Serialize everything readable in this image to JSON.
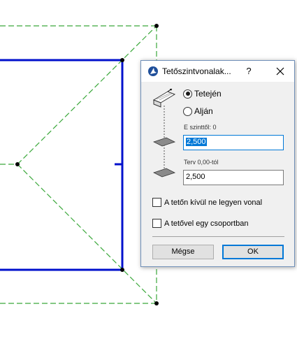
{
  "dialog": {
    "title": "Tetőszintvonalak...",
    "help_label": "?",
    "radio_options": [
      {
        "label": "Tetején",
        "checked": true
      },
      {
        "label": "Alján",
        "checked": false
      }
    ],
    "field1": {
      "label": "E szinttől: 0",
      "value": "2,500"
    },
    "field2": {
      "label": "Terv 0,00-tól",
      "value": "2,500"
    },
    "checkboxes": [
      {
        "label": "A tetőn kívül ne legyen vonal",
        "checked": false
      },
      {
        "label": "A tetővel egy csoportban",
        "checked": false
      }
    ],
    "cancel_label": "Mégse",
    "ok_label": "OK"
  },
  "colors": {
    "wall_blue": "#0010cc",
    "roof_line_green": "#3aa83a",
    "accent": "#0078d7"
  }
}
